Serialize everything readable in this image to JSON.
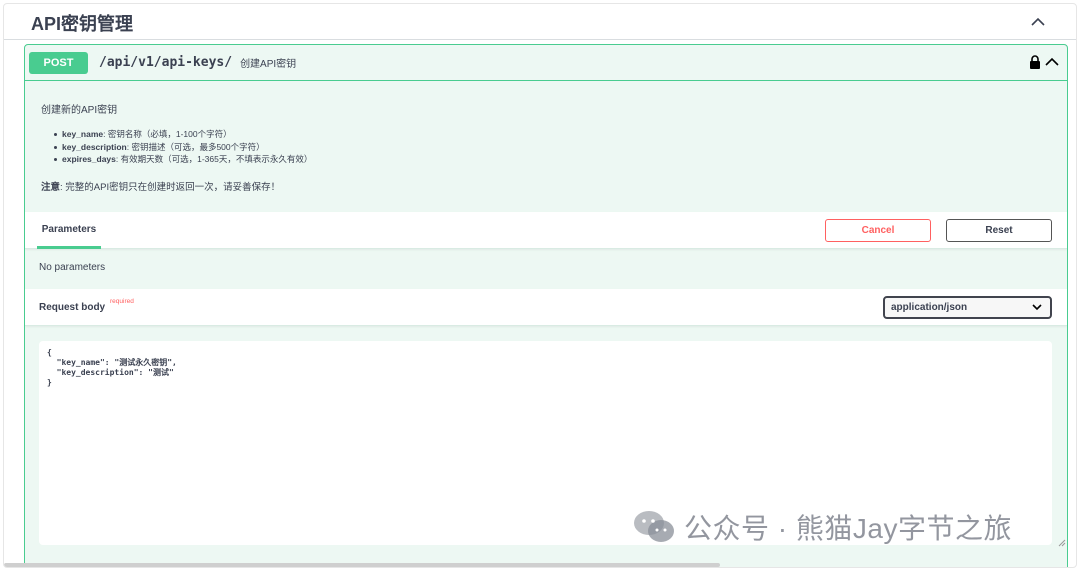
{
  "section": {
    "title": "API密钥管理"
  },
  "operation": {
    "method": "POST",
    "path": "/api/v1/api-keys/",
    "summary": "创建API密钥"
  },
  "description": {
    "intro": "创建新的API密钥",
    "params": [
      {
        "name": "key_name",
        "text": ": 密钥名称（必填，1-100个字符）"
      },
      {
        "name": "key_description",
        "text": ": 密钥描述（可选，最多500个字符）"
      },
      {
        "name": "expires_days",
        "text": ": 有效期天数（可选，1-365天，不填表示永久有效）"
      }
    ],
    "note_label": "注意",
    "note_text": ": 完整的API密钥只在创建时返回一次，请妥善保存！"
  },
  "parameters": {
    "tab_label": "Parameters",
    "cancel_label": "Cancel",
    "reset_label": "Reset",
    "empty_text": "No parameters"
  },
  "request_body": {
    "label": "Request body",
    "required_label": "required",
    "content_type": "application/json",
    "editor_value": "{\n  \"key_name\": \"测试永久密钥\",\n  \"key_description\": \"测试\"\n}"
  },
  "watermark": {
    "text": "公众号 · 熊猫Jay字节之旅"
  },
  "colors": {
    "post": "#49cc90",
    "cancel": "#ff6060",
    "text": "#3b4151"
  }
}
